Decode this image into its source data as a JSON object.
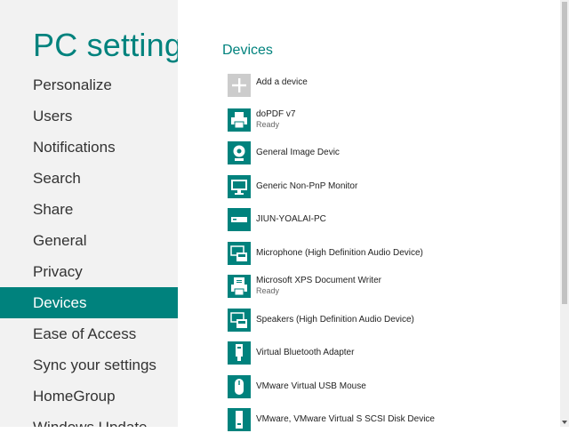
{
  "sidebar": {
    "title": "PC settings",
    "items": [
      {
        "label": "Personalize"
      },
      {
        "label": "Users"
      },
      {
        "label": "Notifications"
      },
      {
        "label": "Search"
      },
      {
        "label": "Share"
      },
      {
        "label": "General"
      },
      {
        "label": "Privacy"
      },
      {
        "label": "Devices",
        "active": true
      },
      {
        "label": "Ease of Access"
      },
      {
        "label": "Sync your settings"
      },
      {
        "label": "HomeGroup"
      },
      {
        "label": "Windows Update"
      }
    ]
  },
  "main": {
    "section_title": "Devices",
    "add_device": {
      "label": "Add a device",
      "icon": "plus-icon"
    },
    "devices": [
      {
        "name": "doPDF v7",
        "status": "Ready",
        "icon": "printer-icon"
      },
      {
        "name": "General Image Devic",
        "status": "",
        "icon": "webcam-icon"
      },
      {
        "name": "Generic Non-PnP Monitor",
        "status": "",
        "icon": "monitor-icon"
      },
      {
        "name": "JIUN-YOALAI-PC",
        "status": "",
        "icon": "computer-icon"
      },
      {
        "name": "Microphone (High Definition Audio Device)",
        "status": "",
        "icon": "audio-device-icon"
      },
      {
        "name": "Microsoft XPS Document Writer",
        "status": "Ready",
        "icon": "document-printer-icon"
      },
      {
        "name": "Speakers (High Definition Audio Device)",
        "status": "",
        "icon": "audio-device-icon"
      },
      {
        "name": "Virtual Bluetooth Adapter",
        "status": "",
        "icon": "usb-adapter-icon"
      },
      {
        "name": "VMware Virtual USB Mouse",
        "status": "",
        "icon": "mouse-icon"
      },
      {
        "name": "VMware, VMware Virtual S SCSI Disk Device",
        "status": "",
        "icon": "disk-drive-icon"
      }
    ]
  },
  "colors": {
    "accent": "#00827d",
    "sidebar_bg": "#f2f2f2",
    "add_tile": "#cccccc"
  }
}
